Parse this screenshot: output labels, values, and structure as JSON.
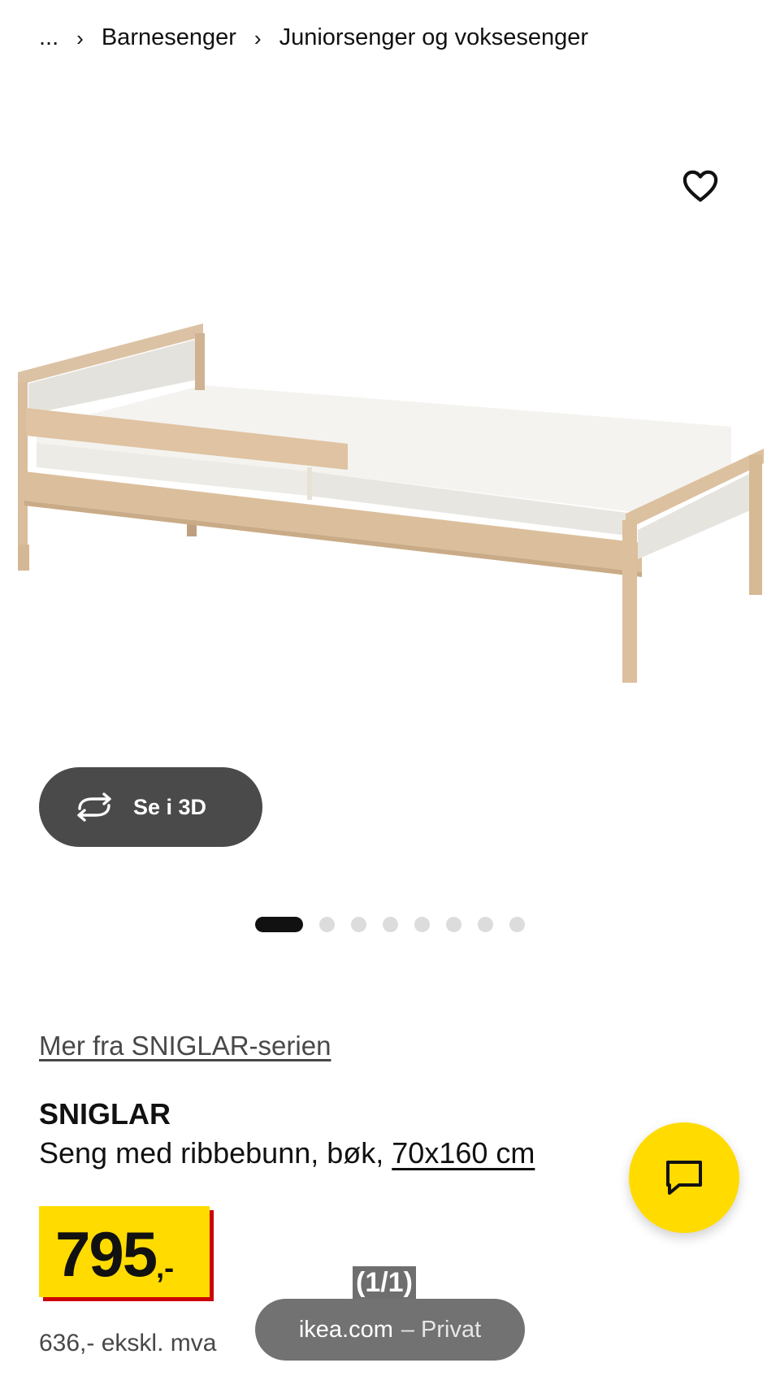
{
  "breadcrumb": {
    "ellipsis": "...",
    "items": [
      "Barnesenger",
      "Juniorsenger og voksesenger"
    ],
    "separator": "›"
  },
  "media": {
    "view3d_label": "Se i 3D",
    "dots_total": 8,
    "active_dot": 0,
    "product_image_icon": "bed-image"
  },
  "product": {
    "series_link": "Mer fra SNIGLAR-serien",
    "name": "SNIGLAR",
    "desc_prefix": "Seng med ribbebunn, bøk, ",
    "size_link": "70x160 cm",
    "price_number": "795",
    "price_suffix": ",-",
    "price_ex_vat": "636,- ekskl. mva"
  },
  "browser": {
    "tab_counter": "(1/1)",
    "url_domain": "ikea.com",
    "url_mode": "– Privat"
  },
  "colors": {
    "ikea_yellow": "#ffdb00",
    "ikea_red": "#cc0008",
    "pill_dark": "#4a4a4a"
  },
  "icons": {
    "favorite": "heart-icon",
    "rotate": "rotate-3d-icon",
    "chat": "chat-icon"
  }
}
